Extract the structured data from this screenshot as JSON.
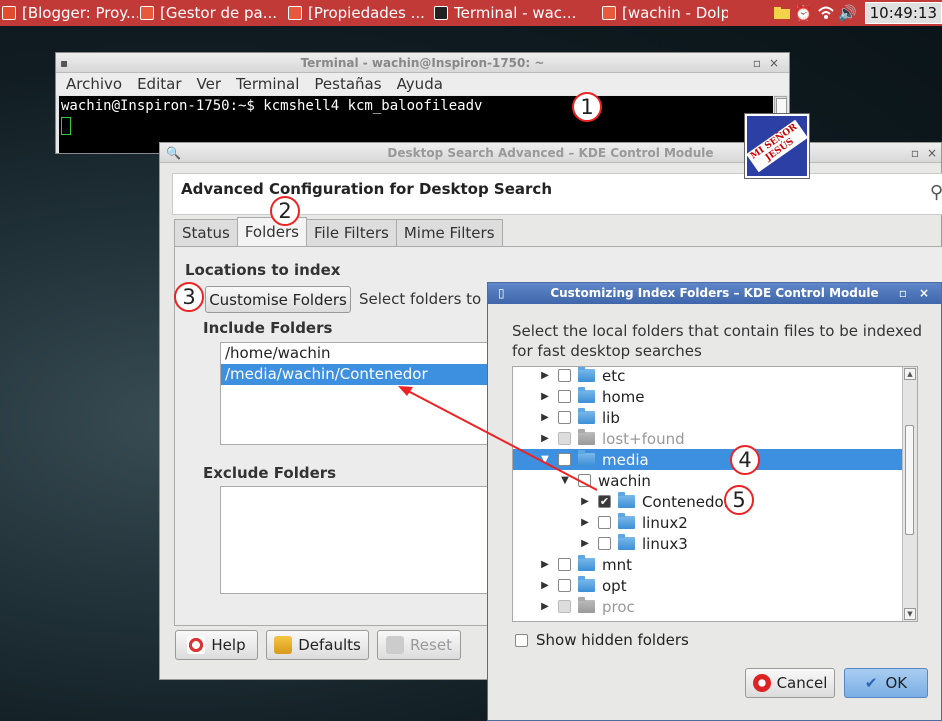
{
  "panel": {
    "tasks": [
      {
        "label": "[Blogger: Proy...",
        "icon": "browser-icon",
        "color": "#e24b2b"
      },
      {
        "label": "[Gestor de pa...",
        "icon": "package-manager-icon",
        "color": "#e8583a"
      },
      {
        "label": "[Propiedades ...",
        "icon": "properties-icon",
        "color": "#e8583a"
      },
      {
        "label": "Terminal - wac...",
        "icon": "terminal-icon",
        "color": "#222222"
      },
      {
        "label": "[wachin - Dolp...",
        "icon": "dolphin-icon",
        "color": "#e8583a"
      }
    ],
    "clock": "10:49:13"
  },
  "terminal": {
    "title": "Terminal - wachin@Inspiron-1750: ~",
    "menu": [
      "Archivo",
      "Editar",
      "Ver",
      "Terminal",
      "Pestañas",
      "Ayuda"
    ],
    "prompt": "wachin@Inspiron-1750:~$ kcmshell4 kcm_baloofileadv"
  },
  "logo": {
    "text": "MI SEÑOR JESÚS"
  },
  "kcm": {
    "title": "Desktop Search Advanced – KDE Control Module",
    "heading": "Advanced Configuration for Desktop Search",
    "tabs": [
      "Status",
      "Folders",
      "File Filters",
      "Mime Filters"
    ],
    "active_tab": "Folders",
    "locations_label": "Locations to index",
    "customise_button": "Customise Folders",
    "customise_hint": "Select folders to b",
    "include_label": "Include Folders",
    "include_folders": [
      "/home/wachin",
      "/media/wachin/Contenedor"
    ],
    "exclude_label": "Exclude Folders",
    "help_button": "Help",
    "defaults_button": "Defaults",
    "reset_button": "Reset"
  },
  "dialog": {
    "title": "Customizing Index Folders – KDE Control Module",
    "description": "Select the local folders that contain files to be indexed for fast desktop searches",
    "tree": [
      {
        "label": "etc",
        "expanded": false,
        "checked": false,
        "dim": false,
        "level": 0,
        "selected": false
      },
      {
        "label": "home",
        "expanded": false,
        "checked": false,
        "dim": false,
        "level": 0,
        "selected": false
      },
      {
        "label": "lib",
        "expanded": false,
        "checked": false,
        "dim": false,
        "level": 0,
        "selected": false
      },
      {
        "label": "lost+found",
        "expanded": false,
        "checked": false,
        "dim": true,
        "level": 0,
        "selected": false
      },
      {
        "label": "media",
        "expanded": true,
        "checked": false,
        "dim": false,
        "level": 0,
        "selected": true
      },
      {
        "label": "wachin",
        "expanded": true,
        "checked": false,
        "dim": false,
        "level": 1,
        "selected": false,
        "no_folder_icon": true
      },
      {
        "label": "Contenedor",
        "expanded": false,
        "checked": true,
        "dim": false,
        "level": 2,
        "selected": false
      },
      {
        "label": "linux2",
        "expanded": false,
        "checked": false,
        "dim": false,
        "level": 2,
        "selected": false
      },
      {
        "label": "linux3",
        "expanded": false,
        "checked": false,
        "dim": false,
        "level": 2,
        "selected": false
      },
      {
        "label": "mnt",
        "expanded": false,
        "checked": false,
        "dim": false,
        "level": 0,
        "selected": false
      },
      {
        "label": "opt",
        "expanded": false,
        "checked": false,
        "dim": false,
        "level": 0,
        "selected": false
      },
      {
        "label": "proc",
        "expanded": false,
        "checked": false,
        "dim": true,
        "level": 0,
        "selected": false
      }
    ],
    "show_hidden_label": "Show hidden folders",
    "cancel_button": "Cancel",
    "ok_button": "OK"
  },
  "callouts": [
    "1",
    "2",
    "3",
    "4",
    "5"
  ]
}
